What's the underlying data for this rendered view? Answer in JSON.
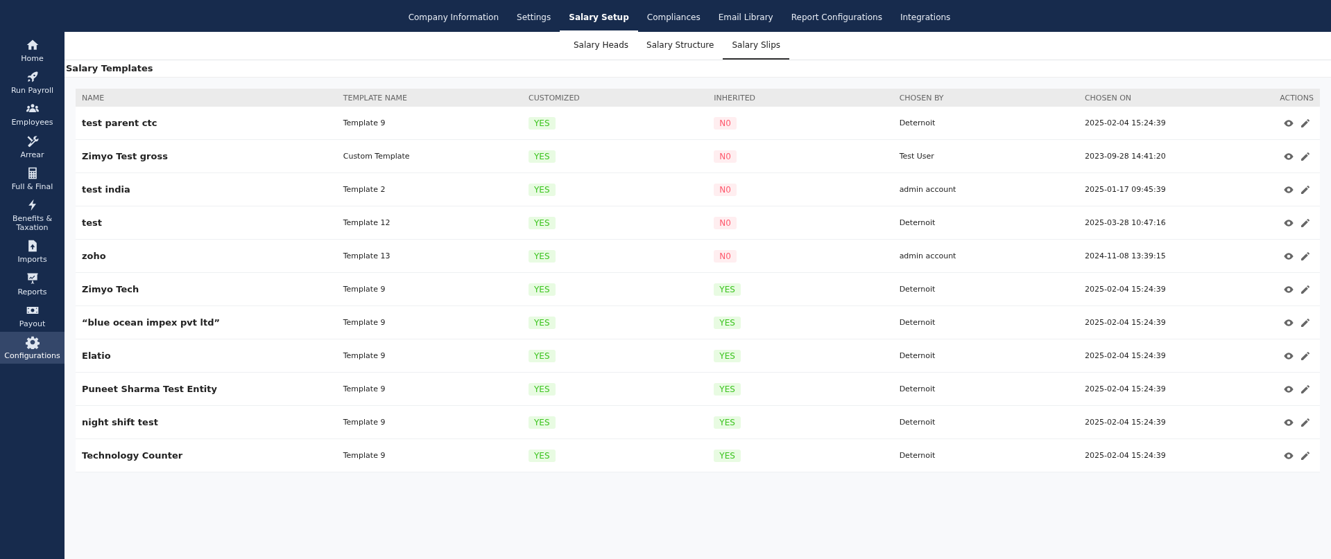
{
  "top_nav": {
    "tabs": [
      {
        "label": "Company Information",
        "selected": false
      },
      {
        "label": "Settings",
        "selected": false
      },
      {
        "label": "Salary Setup",
        "selected": true
      },
      {
        "label": "Compliances",
        "selected": false
      },
      {
        "label": "Email Library",
        "selected": false
      },
      {
        "label": "Report Configurations",
        "selected": false
      },
      {
        "label": "Integrations",
        "selected": false
      }
    ]
  },
  "sidebar": {
    "items": [
      {
        "label": "Home",
        "selected": false
      },
      {
        "label": "Run Payroll",
        "selected": false
      },
      {
        "label": "Employees",
        "selected": false
      },
      {
        "label": "Arrear",
        "selected": false
      },
      {
        "label": "Full & Final",
        "selected": false
      },
      {
        "label": "Benefits & Taxation",
        "selected": false
      },
      {
        "label": "Imports",
        "selected": false
      },
      {
        "label": "Reports",
        "selected": false
      },
      {
        "label": "Payout",
        "selected": false
      },
      {
        "label": "Configurations",
        "selected": true
      }
    ]
  },
  "sub_tabs": [
    {
      "label": "Salary Heads",
      "selected": false
    },
    {
      "label": "Salary Structure",
      "selected": false
    },
    {
      "label": "Salary Slips",
      "selected": true
    }
  ],
  "section_title": "Salary Templates",
  "table": {
    "columns": [
      "NAME",
      "TEMPLATE NAME",
      "CUSTOMIZED",
      "INHERITED",
      "CHOSEN BY",
      "CHOSEN ON",
      "ACTIONS"
    ],
    "rows": [
      {
        "name": "test parent ctc",
        "template": "Template 9",
        "customized": {
          "text": "YES",
          "kind": "success"
        },
        "inherited": {
          "text": "N0",
          "kind": "danger"
        },
        "chosen_by": "Deternoit",
        "chosen_on": "2025-02-04 15:24:39"
      },
      {
        "name": "Zimyo Test gross",
        "template": "Custom Template",
        "customized": {
          "text": "YES",
          "kind": "success"
        },
        "inherited": {
          "text": "N0",
          "kind": "danger"
        },
        "chosen_by": "Test User",
        "chosen_on": "2023-09-28 14:41:20"
      },
      {
        "name": "test india",
        "template": "Template 2",
        "customized": {
          "text": "YES",
          "kind": "success"
        },
        "inherited": {
          "text": "N0",
          "kind": "danger"
        },
        "chosen_by": "admin account",
        "chosen_on": "2025-01-17 09:45:39"
      },
      {
        "name": "test",
        "template": "Template 12",
        "customized": {
          "text": "YES",
          "kind": "success"
        },
        "inherited": {
          "text": "N0",
          "kind": "danger"
        },
        "chosen_by": "Deternoit",
        "chosen_on": "2025-03-28 10:47:16"
      },
      {
        "name": "zoho",
        "template": "Template 13",
        "customized": {
          "text": "YES",
          "kind": "success"
        },
        "inherited": {
          "text": "N0",
          "kind": "danger"
        },
        "chosen_by": "admin account",
        "chosen_on": "2024-11-08 13:39:15"
      },
      {
        "name": "Zimyo Tech",
        "template": "Template 9",
        "customized": {
          "text": "YES",
          "kind": "success"
        },
        "inherited": {
          "text": "YES",
          "kind": "success"
        },
        "chosen_by": "Deternoit",
        "chosen_on": "2025-02-04 15:24:39"
      },
      {
        "name": "“blue ocean impex pvt ltd”",
        "template": "Template 9",
        "customized": {
          "text": "YES",
          "kind": "success"
        },
        "inherited": {
          "text": "YES",
          "kind": "success"
        },
        "chosen_by": "Deternoit",
        "chosen_on": "2025-02-04 15:24:39"
      },
      {
        "name": "Elatio",
        "template": "Template 9",
        "customized": {
          "text": "YES",
          "kind": "success"
        },
        "inherited": {
          "text": "YES",
          "kind": "success"
        },
        "chosen_by": "Deternoit",
        "chosen_on": "2025-02-04 15:24:39"
      },
      {
        "name": "Puneet Sharma Test Entity",
        "template": "Template 9",
        "customized": {
          "text": "YES",
          "kind": "success"
        },
        "inherited": {
          "text": "YES",
          "kind": "success"
        },
        "chosen_by": "Deternoit",
        "chosen_on": "2025-02-04 15:24:39"
      },
      {
        "name": "night shift test",
        "template": "Template 9",
        "customized": {
          "text": "YES",
          "kind": "success"
        },
        "inherited": {
          "text": "YES",
          "kind": "success"
        },
        "chosen_by": "Deternoit",
        "chosen_on": "2025-02-04 15:24:39"
      },
      {
        "name": "Technology Counter",
        "template": "Template 9",
        "customized": {
          "text": "YES",
          "kind": "success"
        },
        "inherited": {
          "text": "YES",
          "kind": "success"
        },
        "chosen_by": "Deternoit",
        "chosen_on": "2025-02-04 15:24:39"
      }
    ]
  }
}
